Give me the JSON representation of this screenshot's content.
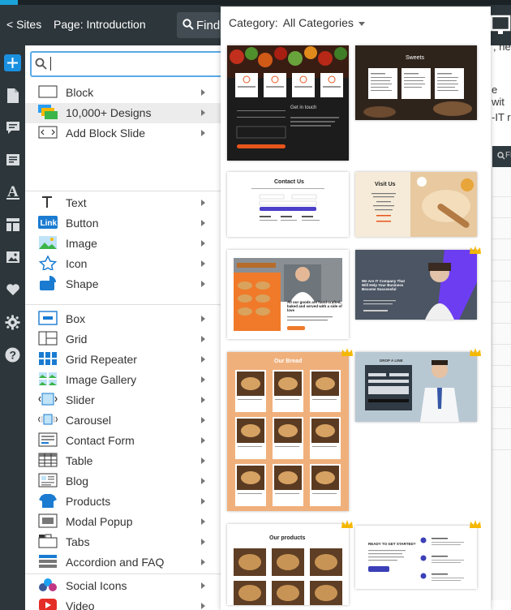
{
  "topbar": {
    "sites_label": "< Sites",
    "page_label": "Page: Introduction",
    "find_label": "Find"
  },
  "background": {
    "line1": ", ne",
    "line2": "e wit",
    "line3": "-IT r",
    "fi_label": "Fi"
  },
  "search": {
    "placeholder": "",
    "value": ""
  },
  "menu": {
    "groups": [
      [
        {
          "label": "Block",
          "icon": "block-icon"
        },
        {
          "label": "10,000+ Designs",
          "icon": "designs-icon",
          "highlighted": true
        },
        {
          "label": "Add Block Slide",
          "icon": "block-slide-icon"
        }
      ],
      [
        {
          "label": "Text",
          "icon": "text-icon"
        },
        {
          "label": "Button",
          "icon": "link-button-icon",
          "icon_text": "Link"
        },
        {
          "label": "Image",
          "icon": "image-icon"
        },
        {
          "label": "Icon",
          "icon": "star-icon"
        },
        {
          "label": "Shape",
          "icon": "shape-icon"
        }
      ],
      [
        {
          "label": "Box",
          "icon": "box-icon"
        },
        {
          "label": "Grid",
          "icon": "grid-icon"
        },
        {
          "label": "Grid Repeater",
          "icon": "grid-repeater-icon"
        },
        {
          "label": "Image Gallery",
          "icon": "image-gallery-icon"
        },
        {
          "label": "Slider",
          "icon": "slider-icon"
        },
        {
          "label": "Carousel",
          "icon": "carousel-icon"
        },
        {
          "label": "Contact Form",
          "icon": "contact-form-icon"
        },
        {
          "label": "Table",
          "icon": "table-icon"
        },
        {
          "label": "Blog",
          "icon": "blog-icon"
        },
        {
          "label": "Products",
          "icon": "products-icon"
        },
        {
          "label": "Modal Popup",
          "icon": "modal-popup-icon"
        },
        {
          "label": "Tabs",
          "icon": "tabs-icon"
        },
        {
          "label": "Accordion and FAQ",
          "icon": "accordion-icon"
        }
      ],
      [
        {
          "label": "Social Icons",
          "icon": "social-icons-icon"
        },
        {
          "label": "Video",
          "icon": "video-icon"
        },
        {
          "label": "Google Maps",
          "icon": "map-pin-icon"
        }
      ]
    ]
  },
  "gallery": {
    "category_label": "Category:",
    "category_value": "All Categories",
    "tiles": [
      {
        "name": "contact-dark-food",
        "heading": "Get in touch",
        "crown": false
      },
      {
        "name": "sweets-menu",
        "heading": "Sweets",
        "crown": false
      },
      {
        "name": "contact-us-form",
        "heading": "Contact Us",
        "crown": false
      },
      {
        "name": "visit-us",
        "heading": "Visit Us",
        "crown": false
      },
      {
        "name": "bakery-chef",
        "heading": "All our goods are hand-crafted, baked and served with a side of love",
        "crown": false
      },
      {
        "name": "it-company",
        "heading": "We Are IT Company That Will Help Your Business Become Successful",
        "crown": true
      },
      {
        "name": "our-bread",
        "heading": "Our Bread",
        "crown": true
      },
      {
        "name": "drop-a-line",
        "heading": "DROP A LINE",
        "crown": true
      },
      {
        "name": "our-products",
        "heading": "Our products",
        "crown": true
      },
      {
        "name": "ready-to-get-started",
        "heading": "READY TO GET STARTED?",
        "crown": true
      }
    ]
  },
  "colors": {
    "topbar": "#2d363b",
    "accent": "#1a90e0",
    "crown": "#f5b800",
    "orange": "#f07a2a",
    "bread_bg": "#f0b07c"
  }
}
